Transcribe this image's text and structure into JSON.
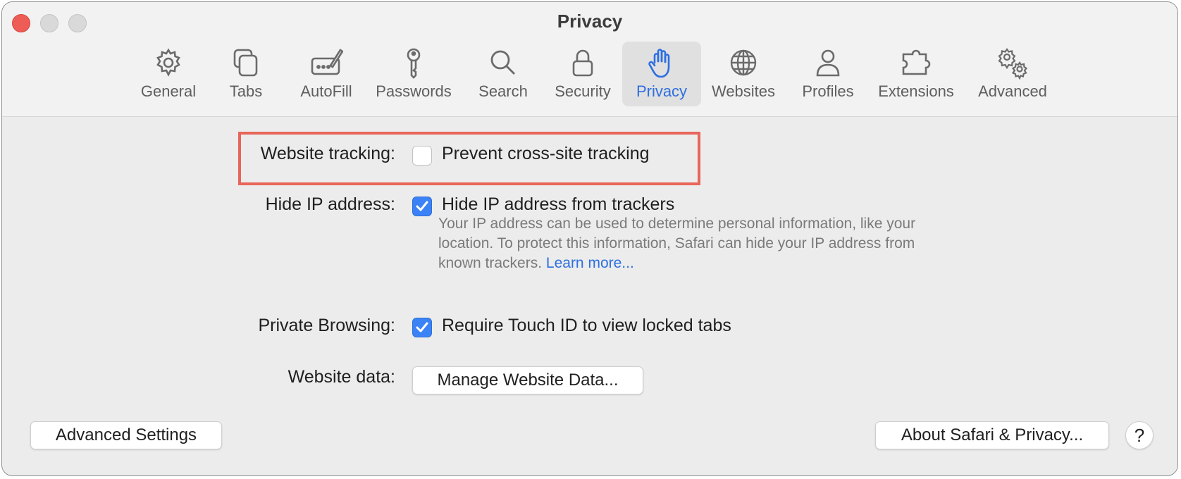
{
  "window": {
    "title": "Privacy"
  },
  "toolbar": {
    "items": [
      {
        "label": "General",
        "icon": "gear-icon"
      },
      {
        "label": "Tabs",
        "icon": "tabs-icon"
      },
      {
        "label": "AutoFill",
        "icon": "autofill-pen-icon"
      },
      {
        "label": "Passwords",
        "icon": "key-icon"
      },
      {
        "label": "Search",
        "icon": "magnifier-icon"
      },
      {
        "label": "Security",
        "icon": "lock-icon"
      },
      {
        "label": "Privacy",
        "icon": "hand-icon",
        "selected": true
      },
      {
        "label": "Websites",
        "icon": "globe-icon"
      },
      {
        "label": "Profiles",
        "icon": "person-icon"
      },
      {
        "label": "Extensions",
        "icon": "puzzle-icon"
      },
      {
        "label": "Advanced",
        "icon": "gears-icon"
      }
    ]
  },
  "settings": {
    "tracking": {
      "label": "Website tracking:",
      "checkbox_label": "Prevent cross-site tracking",
      "checked": false
    },
    "hide_ip": {
      "label": "Hide IP address:",
      "checkbox_label": "Hide IP address from trackers",
      "checked": true,
      "description": "Your IP address can be used to determine personal information, like your location. To protect this information, Safari can hide your IP address from known trackers.",
      "learn_more": "Learn more..."
    },
    "private_browsing": {
      "label": "Private Browsing:",
      "checkbox_label": "Require Touch ID to view locked tabs",
      "checked": true
    },
    "website_data": {
      "label": "Website data:",
      "button_label": "Manage Website Data..."
    }
  },
  "footer": {
    "advanced_button": "Advanced Settings",
    "about_button": "About Safari & Privacy...",
    "help_button": "?"
  },
  "colors": {
    "accent": "#2d6fe0",
    "checkbox": "#3a82f6",
    "highlight": "#e8655a",
    "close": "#ee5d55"
  }
}
